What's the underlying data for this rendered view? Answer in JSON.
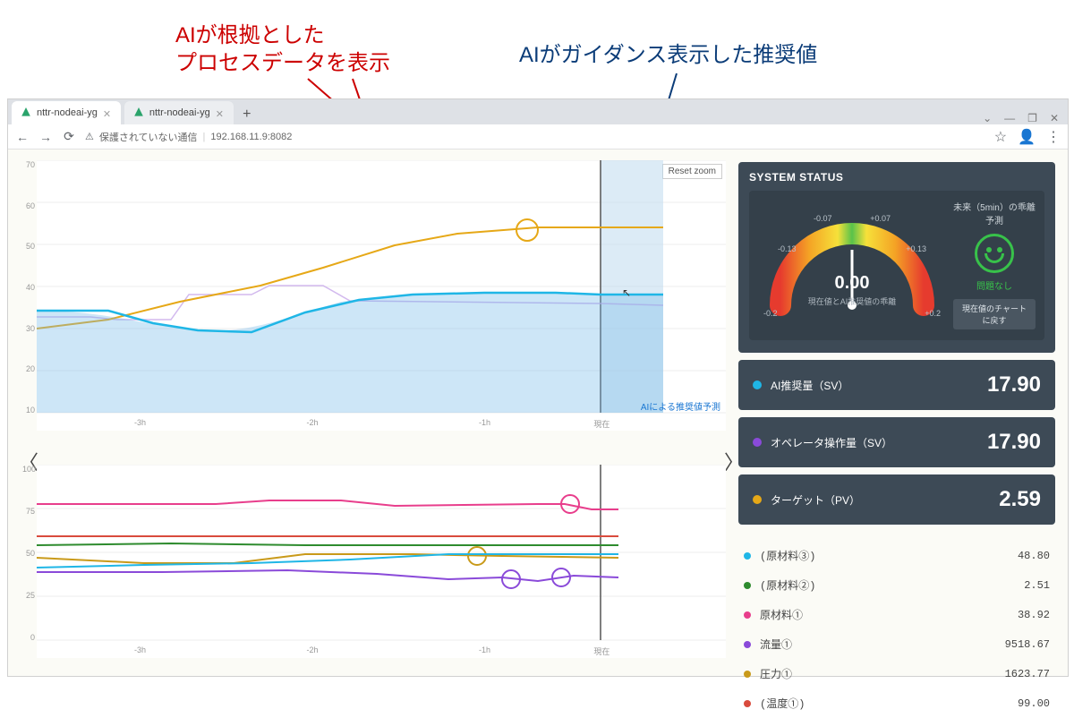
{
  "annotations": {
    "red_label_line1": "AIが根拠とした",
    "red_label_line2": "プロセスデータを表示",
    "navy_label": "AIがガイダンス表示した推奨値"
  },
  "browser": {
    "tabs": [
      {
        "title": "nttr-nodeai-yg"
      },
      {
        "title": "nttr-nodeai-yg"
      }
    ],
    "security_text": "保護されていない通信",
    "url": "192.168.11.9:8082"
  },
  "chart1": {
    "yticks": [
      "70",
      "60",
      "50",
      "40",
      "30",
      "20",
      "10"
    ],
    "xticks": [
      "-3h",
      "-2h",
      "-1h",
      "現在"
    ],
    "reset_label": "Reset zoom",
    "note": "AIによる推奨値予測"
  },
  "chart2": {
    "yticks": [
      "100",
      "75",
      "50",
      "25",
      "0"
    ],
    "xticks": [
      "-3h",
      "-2h",
      "-1h",
      "現在"
    ]
  },
  "status": {
    "title": "SYSTEM STATUS",
    "ticks": {
      "far_left": "-0.2",
      "left": "-0.07",
      "right": "+0.07",
      "far_right": "+0.2",
      "mid_left": "-0.13",
      "mid_right": "+0.13"
    },
    "value": "0.00",
    "value_caption": "現在値とAI推奨値の乖離",
    "future_caption": "未来（5min）の乖離予測",
    "future_status": "問題なし",
    "reset_chart": "現在値のチャートに戻す"
  },
  "metrics": [
    {
      "color": "#1fb6e6",
      "name": "AI推奨量（SV）",
      "value": "17.90"
    },
    {
      "color": "#8a4ad9",
      "name": "オペレータ操作量（SV）",
      "value": "17.90"
    },
    {
      "color": "#e6a817",
      "name": "ターゲット（PV）",
      "value": "2.59"
    }
  ],
  "legend": [
    {
      "color": "#1fb6e6",
      "name": "(原材料③)",
      "value": "48.80"
    },
    {
      "color": "#2e8b2e",
      "name": "(原材料②)",
      "value": "2.51"
    },
    {
      "color": "#e83e8c",
      "name": "原材料①",
      "value": "38.92"
    },
    {
      "color": "#8a4ad9",
      "name": "流量①",
      "value": "9518.67"
    },
    {
      "color": "#c99a1a",
      "name": "圧力①",
      "value": "1623.77"
    },
    {
      "color": "#d94b3d",
      "name": "(温度①)",
      "value": "99.00"
    }
  ],
  "chart_data": [
    {
      "type": "line",
      "title": "",
      "xlabel": "",
      "ylabel": "",
      "ylim": [
        10,
        70
      ],
      "categories": [
        "-3h",
        "-2h",
        "-1h",
        "現在"
      ],
      "series": [
        {
          "name": "オペレータ操作量（SV）",
          "color": "#c7a8ea",
          "values": [
            32,
            32,
            40,
            35
          ]
        },
        {
          "name": "ターゲット（PV）",
          "color": "#e6a817",
          "values": [
            30,
            38,
            53,
            54
          ]
        },
        {
          "name": "AI推奨量（SV）",
          "color": "#1fb6e6",
          "values": [
            34,
            31,
            38,
            38
          ]
        }
      ],
      "shaded_region": {
        "from": "現在",
        "note": "AIによる推奨値予測"
      }
    },
    {
      "type": "line",
      "title": "",
      "xlabel": "",
      "ylabel": "",
      "ylim": [
        0,
        100
      ],
      "categories": [
        "-3h",
        "-2h",
        "-1h",
        "現在"
      ],
      "series": [
        {
          "name": "原材料①",
          "color": "#e83e8c",
          "values": [
            78,
            78,
            78,
            75
          ]
        },
        {
          "name": "温度①",
          "color": "#d94b3d",
          "values": [
            60,
            60,
            59,
            60
          ]
        },
        {
          "name": "原材料②",
          "color": "#2e8b2e",
          "values": [
            55,
            56,
            55,
            55
          ]
        },
        {
          "name": "圧力①",
          "color": "#c99a1a",
          "values": [
            48,
            45,
            49,
            48
          ]
        },
        {
          "name": "原材料③",
          "color": "#1fb6e6",
          "values": [
            42,
            44,
            48,
            50
          ]
        },
        {
          "name": "流量①",
          "color": "#8a4ad9",
          "values": [
            40,
            40,
            38,
            36
          ]
        }
      ]
    }
  ]
}
